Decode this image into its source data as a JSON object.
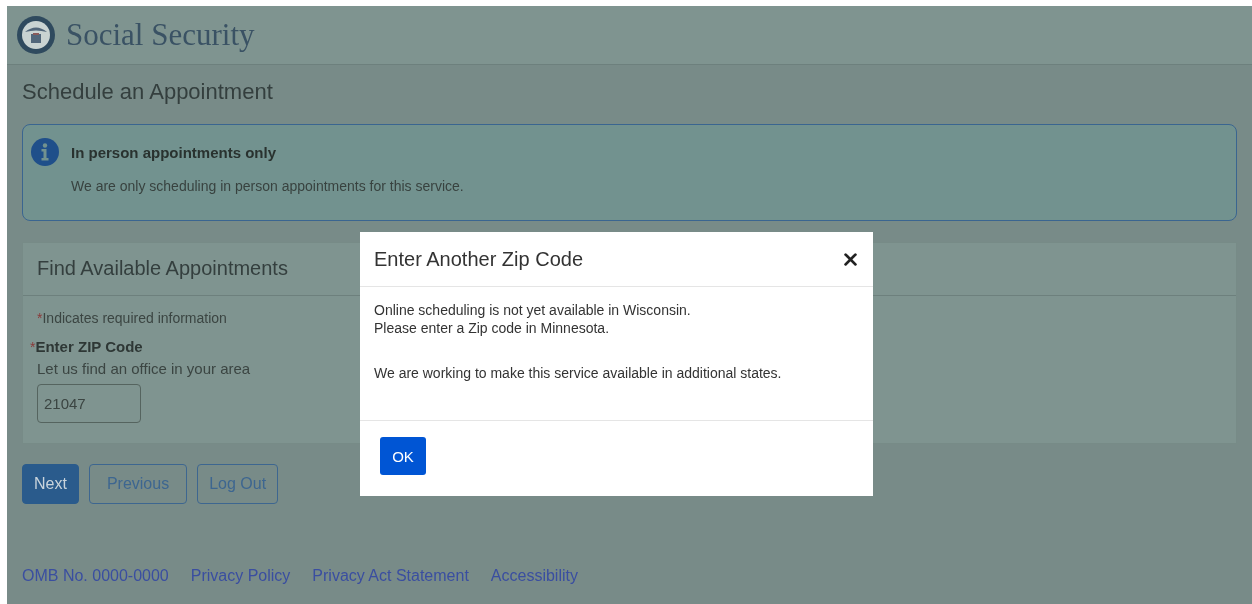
{
  "header": {
    "title": "Social Security"
  },
  "page_title": "Schedule an Appointment",
  "alert": {
    "title": "In person appointments only",
    "text": "We are only scheduling in person appointments for this service."
  },
  "panel": {
    "title": "Find Available Appointments",
    "required_mark": "*",
    "required_note": "Indicates required information",
    "field": {
      "required_mark": "*",
      "label": "Enter ZIP Code",
      "hint": "Let us find an office in your area",
      "value": "21047"
    }
  },
  "buttons": [
    {
      "label": "Next",
      "kind": "primary"
    },
    {
      "label": "Previous",
      "kind": "secondary"
    },
    {
      "label": "Log Out",
      "kind": "secondary"
    }
  ],
  "footer": {
    "omb": "OMB No. 0000-0000",
    "links": [
      "Privacy Policy",
      "Privacy Act Statement",
      "Accessibility"
    ]
  },
  "modal": {
    "title": "Enter Another Zip Code",
    "lines": [
      "Online scheduling is not yet available in Wisconsin.",
      "Please enter a Zip code in Minnesota."
    ],
    "note": "We are working to make this service available in additional states.",
    "ok": "OK"
  }
}
